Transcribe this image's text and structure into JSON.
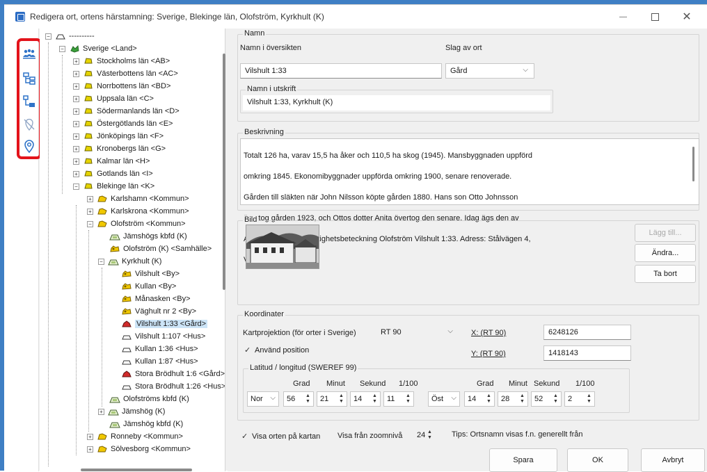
{
  "window": {
    "title": "Redigera ort, ortens härstamning: Sverige, Blekinge län, Olofström, Kyrkhult (K)",
    "close_glyph": "✕"
  },
  "toolbar": {
    "icons": [
      "people-icon",
      "tree-icon",
      "hierarchy-icon",
      "no-location-icon",
      "location-pin-icon"
    ],
    "highlight_color": "#e3131b"
  },
  "tree": {
    "root": "----------",
    "sverige": "Sverige <Land>",
    "lan": [
      "Stockholms län <AB>",
      "Västerbottens län <AC>",
      "Norrbottens län <BD>",
      "Uppsala län <C>",
      "Södermanlands län <D>",
      "Östergötlands län <E>",
      "Jönköpings län <F>",
      "Kronobergs län <G>",
      "Kalmar län <H>",
      "Gotlands län <I>",
      "Blekinge län <K>"
    ],
    "karlshamn": "Karlshamn <Kommun>",
    "karlskrona": "Karlskrona <Kommun>",
    "olofstrom": "Olofström <Kommun>",
    "jamshogs_kbfd": "Jämshögs kbfd (K)",
    "olofstrom_samh": "Olofström (K) <Samhälle>",
    "kyrkhult": "Kyrkhult (K)",
    "kyrkhult_children": [
      "Vilshult <By>",
      "Kullan <By>",
      "Månasken <By>",
      "Väghult nr 2 <By>",
      "Vilshult 1:33 <Gård>",
      "Vilshult 1:107 <Hus>",
      "Kullan 1:36 <Hus>",
      "Kullan 1:87 <Hus>",
      "Stora Brödhult 1:6 <Gård>",
      "Stora Brödhult 1:26 <Hus>"
    ],
    "olofstroms_kbfd": "Olofströms kbfd (K)",
    "jamshog": "Jämshög (K)",
    "jamshog_kbfd": "Jämshög kbfd (K)",
    "ronneby": "Ronneby <Kommun>",
    "solvesborg": "Sölvesborg <Kommun>"
  },
  "namn": {
    "group_label": "Namn",
    "oversikt_label": "Namn i översikten",
    "oversikt_value": "Vilshult 1:33",
    "slag_label": "Slag av ort",
    "slag_value": "Gård",
    "utskrift_group": "Namn i utskrift",
    "utskrift_value": "Vilshult 1:33, Kyrkhult (K)"
  },
  "beskrivning": {
    "label": "Beskrivning",
    "lines": [
      "Totalt 126 ha, varav 15,5 ha åker och 110,5 ha skog (1945). Mansbyggnaden uppförd",
      "omkring 1845. Ekonomibyggnader uppförda omkring 1900, senare renoverade.",
      "Gården till släkten när John Nilsson köpte gården 1880. Hans son Otto Johnsson",
      "övertog gården 1923, och Ottos dotter Anita övertog den senare. Idag ägs den av",
      "Anitas svärdotter. Fastighetsbeteckning Olofström Vilshult 1:33. Adress: Stålvägen 4,",
      "Vilshult."
    ]
  },
  "bild": {
    "label": "Bild",
    "add_button": "Lägg till...",
    "change_button": "Ändra...",
    "remove_button": "Ta bort"
  },
  "koordinater": {
    "label": "Koordinater",
    "projection_label": "Kartprojektion (för orter i Sverige)",
    "projection_value": "RT 90",
    "x_label": "X: (RT 90)",
    "x_value": "6248126",
    "y_label": "Y: (RT 90)",
    "y_value": "1418143",
    "use_position": "Använd position",
    "latlon_label": "Latitud / longitud (SWEREF 99)",
    "headers_lat": [
      "Grad",
      "Minut",
      "Sekund",
      "1/100"
    ],
    "headers_lon": [
      "Grad",
      "Minut",
      "Sekund",
      "1/100"
    ],
    "lat_dir": "Nor",
    "lat_values": [
      "56",
      "21",
      "14",
      "11"
    ],
    "lon_dir": "Öst",
    "lon_values": [
      "14",
      "28",
      "52",
      "2"
    ]
  },
  "footer": {
    "show_on_map": "Visa orten på kartan",
    "zoom_label": "Visa från zoomnivå",
    "zoom_value": "24",
    "tip": "Tips: Ortsnamn visas f.n. generellt från",
    "save": "Spara",
    "ok": "OK",
    "cancel": "Avbryt"
  }
}
